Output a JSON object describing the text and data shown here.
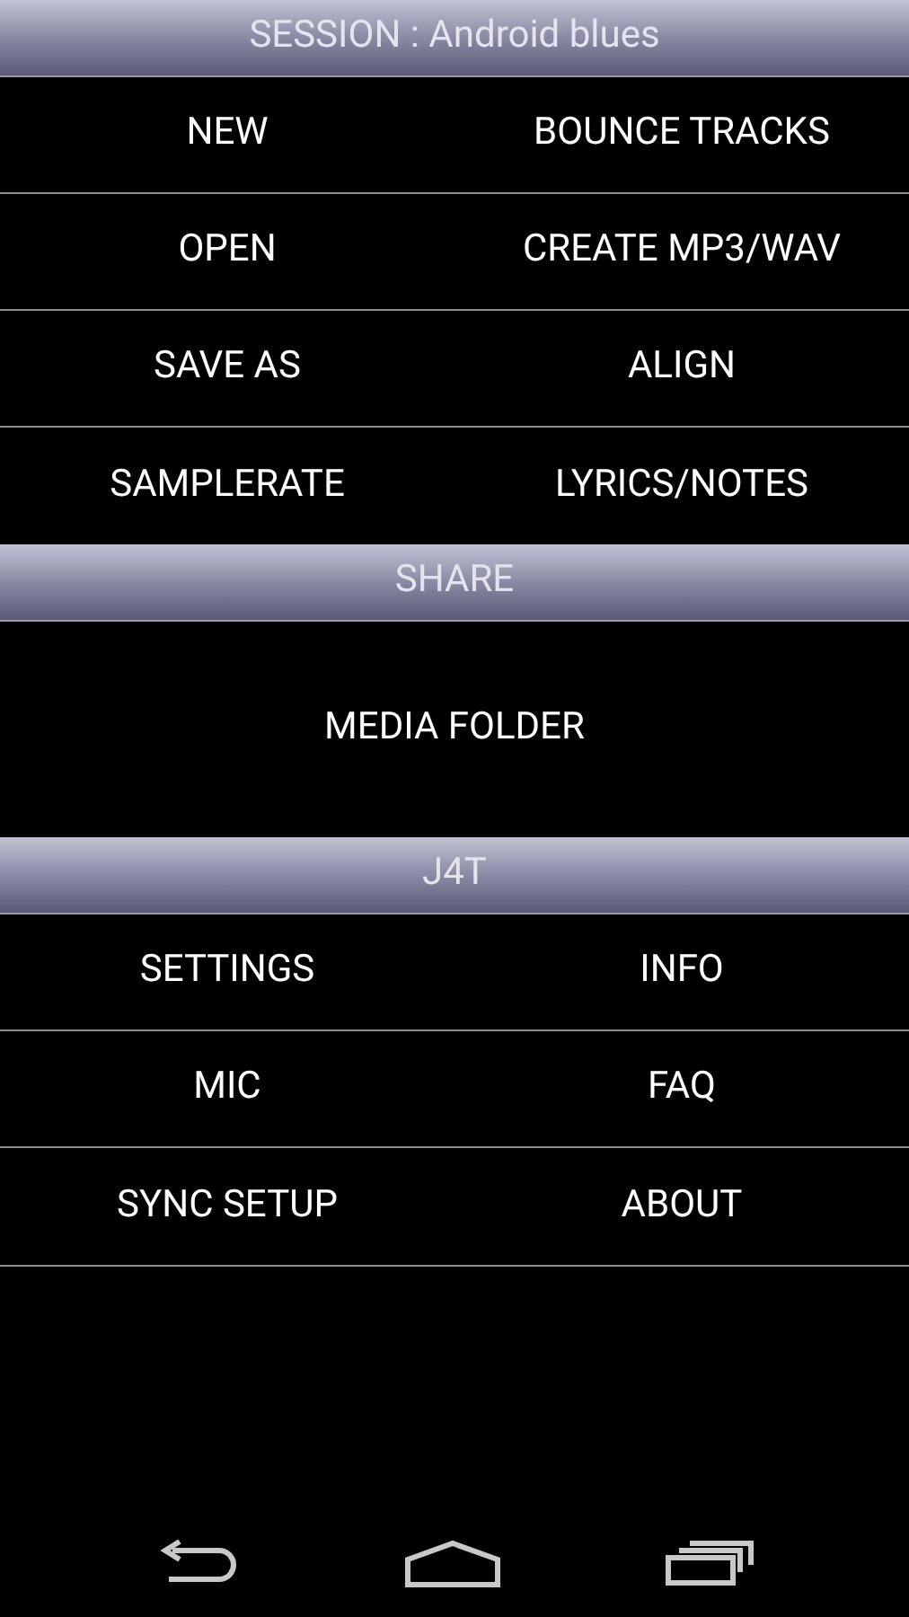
{
  "sections": [
    {
      "title": "SESSION : Android blues",
      "kind": "grid",
      "items": [
        "NEW",
        "BOUNCE TRACKS",
        "OPEN",
        "CREATE MP3/WAV",
        "SAVE AS",
        "ALIGN",
        "SAMPLERATE",
        "LYRICS/NOTES"
      ]
    },
    {
      "title": "SHARE",
      "kind": "single",
      "items": [
        "MEDIA FOLDER"
      ]
    },
    {
      "title": "J4T",
      "kind": "grid",
      "items": [
        "SETTINGS",
        "INFO",
        "MIC",
        "FAQ",
        "SYNC SETUP",
        "ABOUT"
      ]
    }
  ]
}
